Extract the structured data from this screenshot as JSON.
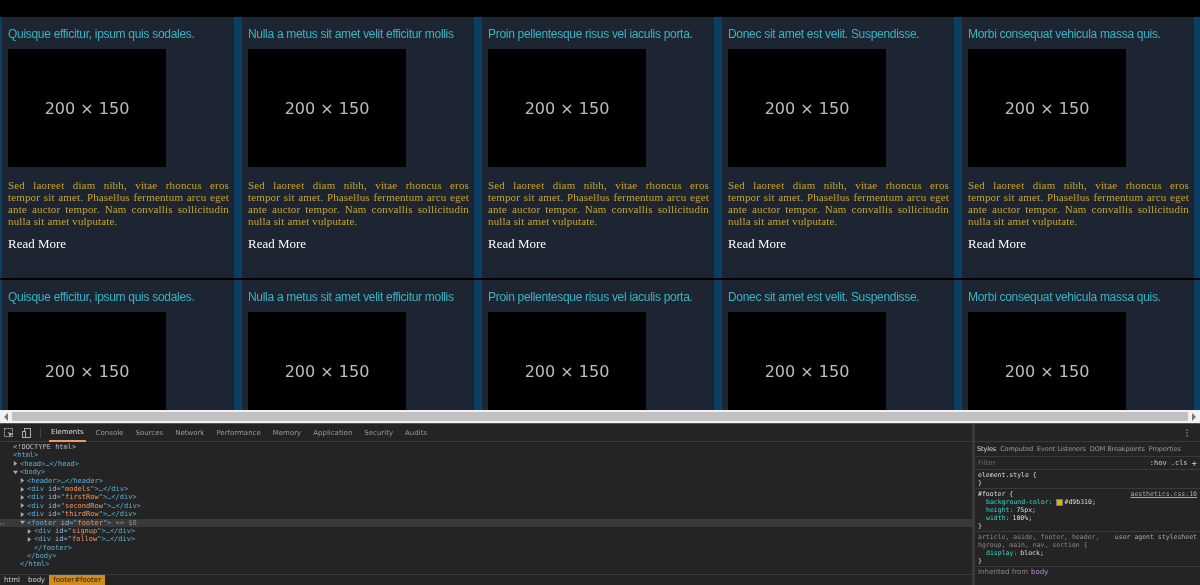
{
  "rows": [
    {
      "cards": [
        {
          "title": "Quisque efficitur, ipsum quis sodales.",
          "image_label": "200 × 150",
          "body": "Sed laoreet diam nibh, vitae rhoncus eros tempor sit amet. Phasellus fermentum arcu eget ante auctor tempor. Nam convallis sollicitudin nulla sit amet vulputate.",
          "link": "Read More"
        },
        {
          "title": "Nulla a metus sit amet velit efficitur mollis",
          "image_label": "200 × 150",
          "body": "Sed laoreet diam nibh, vitae rhoncus eros tempor sit amet. Phasellus fermentum arcu eget ante auctor tempor. Nam convallis sollicitudin nulla sit amet vulputate.",
          "link": "Read More"
        },
        {
          "title": "Proin pellentesque risus vel iaculis porta.",
          "image_label": "200 × 150",
          "body": "Sed laoreet diam nibh, vitae rhoncus eros tempor sit amet. Phasellus fermentum arcu eget ante auctor tempor. Nam convallis sollicitudin nulla sit amet vulputate.",
          "link": "Read More"
        },
        {
          "title": "Donec sit amet est velit. Suspendisse.",
          "image_label": "200 × 150",
          "body": "Sed laoreet diam nibh, vitae rhoncus eros tempor sit amet. Phasellus fermentum arcu eget ante auctor tempor. Nam convallis sollicitudin nulla sit amet vulputate.",
          "link": "Read More"
        },
        {
          "title": "Morbi consequat vehicula massa quis.",
          "image_label": "200 × 150",
          "body": "Sed laoreet diam nibh, vitae rhoncus eros tempor sit amet. Phasellus fermentum arcu eget ante auctor tempor. Nam convallis sollicitudin nulla sit amet vulputate.",
          "link": "Read More"
        }
      ]
    },
    {
      "cards": [
        {
          "title": "Quisque efficitur, ipsum quis sodales.",
          "image_label": "200 × 150"
        },
        {
          "title": "Nulla a metus sit amet velit efficitur mollis",
          "image_label": "200 × 150"
        },
        {
          "title": "Proin pellentesque risus vel iaculis porta.",
          "image_label": "200 × 150"
        },
        {
          "title": "Donec sit amet est velit. Suspendisse.",
          "image_label": "200 × 150"
        },
        {
          "title": "Morbi consequat vehicula massa quis.",
          "image_label": "200 × 150"
        }
      ]
    }
  ],
  "devtools": {
    "tabs": [
      {
        "label": "Elements",
        "selected": true
      },
      {
        "label": "Console",
        "selected": false
      },
      {
        "label": "Sources",
        "selected": false
      },
      {
        "label": "Network",
        "selected": false
      },
      {
        "label": "Performance",
        "selected": false
      },
      {
        "label": "Memory",
        "selected": false
      },
      {
        "label": "Application",
        "selected": false
      },
      {
        "label": "Security",
        "selected": false
      },
      {
        "label": "Audits",
        "selected": false
      }
    ],
    "dom_tree": [
      {
        "segments": [
          {
            "kind": "doctype",
            "text": "<!DOCTYPE html>"
          }
        ],
        "selected": false
      },
      {
        "segments": [
          {
            "kind": "tag",
            "text": "<html>"
          }
        ],
        "selected": false,
        "children": [
          {
            "segments": [
              {
                "kind": "tag",
                "text": "<head>…</head>"
              }
            ],
            "expanded": false,
            "selected": false
          },
          {
            "segments": [
              {
                "kind": "tag",
                "text": "<body>"
              }
            ],
            "expanded": true,
            "selected": false,
            "children": [
              {
                "segments": [
                  {
                    "kind": "tag",
                    "text": "<header>…</header>"
                  }
                ],
                "expanded": false,
                "selected": false
              },
              {
                "segments": [
                  {
                    "kind": "tag",
                    "text": "<div "
                  },
                  {
                    "kind": "attr",
                    "text": "id"
                  },
                  {
                    "kind": "tag",
                    "text": "=\""
                  },
                  {
                    "kind": "value",
                    "text": "models"
                  },
                  {
                    "kind": "tag",
                    "text": "\">…</div>"
                  }
                ],
                "expanded": false,
                "selected": false
              },
              {
                "segments": [
                  {
                    "kind": "tag",
                    "text": "<div "
                  },
                  {
                    "kind": "attr",
                    "text": "id"
                  },
                  {
                    "kind": "tag",
                    "text": "=\""
                  },
                  {
                    "kind": "value",
                    "text": "firstRow"
                  },
                  {
                    "kind": "tag",
                    "text": "\">…</div>"
                  }
                ],
                "expanded": false,
                "selected": false
              },
              {
                "segments": [
                  {
                    "kind": "tag",
                    "text": "<div "
                  },
                  {
                    "kind": "attr",
                    "text": "id"
                  },
                  {
                    "kind": "tag",
                    "text": "=\""
                  },
                  {
                    "kind": "value",
                    "text": "secondRow"
                  },
                  {
                    "kind": "tag",
                    "text": "\">…</div>"
                  }
                ],
                "expanded": false,
                "selected": false
              },
              {
                "segments": [
                  {
                    "kind": "tag",
                    "text": "<div "
                  },
                  {
                    "kind": "attr",
                    "text": "id"
                  },
                  {
                    "kind": "tag",
                    "text": "=\""
                  },
                  {
                    "kind": "value",
                    "text": "thirdRow"
                  },
                  {
                    "kind": "tag",
                    "text": "\">…</div>"
                  }
                ],
                "expanded": false,
                "selected": false
              },
              {
                "segments": [
                  {
                    "kind": "tag",
                    "text": "<footer "
                  },
                  {
                    "kind": "attr",
                    "text": "id"
                  },
                  {
                    "kind": "tag",
                    "text": "=\""
                  },
                  {
                    "kind": "value",
                    "text": "footer"
                  },
                  {
                    "kind": "tag",
                    "text": "\">"
                  },
                  {
                    "kind": "note",
                    "text": " == $0"
                  }
                ],
                "expanded": true,
                "selected": true,
                "children": [
                  {
                    "segments": [
                      {
                        "kind": "tag",
                        "text": "<div "
                      },
                      {
                        "kind": "attr",
                        "text": "id"
                      },
                      {
                        "kind": "tag",
                        "text": "=\""
                      },
                      {
                        "kind": "value",
                        "text": "signup"
                      },
                      {
                        "kind": "tag",
                        "text": "\">…</div>"
                      }
                    ],
                    "expanded": false,
                    "selected": false
                  },
                  {
                    "segments": [
                      {
                        "kind": "tag",
                        "text": "<div "
                      },
                      {
                        "kind": "attr",
                        "text": "id"
                      },
                      {
                        "kind": "tag",
                        "text": "=\""
                      },
                      {
                        "kind": "value",
                        "text": "follow"
                      },
                      {
                        "kind": "tag",
                        "text": "\">…</div>"
                      }
                    ],
                    "expanded": false,
                    "selected": false
                  },
                  {
                    "segments": [
                      {
                        "kind": "tag",
                        "text": "</footer>"
                      }
                    ],
                    "selected": false
                  }
                ]
              },
              {
                "segments": [
                  {
                    "kind": "tag",
                    "text": "</body>"
                  }
                ],
                "selected": false
              }
            ]
          },
          {
            "segments": [
              {
                "kind": "tag",
                "text": "</html>"
              }
            ],
            "selected": false
          }
        ]
      }
    ],
    "breadcrumbs": [
      {
        "label": "html",
        "selected": false
      },
      {
        "label": "body",
        "selected": false
      },
      {
        "label": "footer#footer",
        "selected": true
      }
    ],
    "styles": {
      "tabs": [
        {
          "label": "Styles",
          "selected": true
        },
        {
          "label": "Computed",
          "selected": false
        },
        {
          "label": "Event Listeners",
          "selected": false
        },
        {
          "label": "DOM Breakpoints",
          "selected": false
        },
        {
          "label": "Properties",
          "selected": false
        }
      ],
      "filter_placeholder": "Filter",
      "hov": ":hov",
      "cls": ".cls",
      "add": "+",
      "rules": [
        {
          "selector": "element.style {",
          "close": "}"
        },
        {
          "selector": "#footer {",
          "source": "aesthetics.css:10",
          "declarations": [
            {
              "name": "background-color:",
              "value": "#d9b310;",
              "swatch": true
            },
            {
              "name": "height:",
              "value": "75px;"
            },
            {
              "name": "width:",
              "value": "100%;"
            }
          ],
          "close": "}"
        },
        {
          "selector": "article, aside, footer, header, hgroup, main, nav, section {",
          "source": "user agent stylesheet",
          "declarations": [
            {
              "name": "display:",
              "value": "block;"
            }
          ],
          "close": "}"
        }
      ],
      "inherited_label": "Inherited from",
      "inherited_tag": "body"
    }
  }
}
